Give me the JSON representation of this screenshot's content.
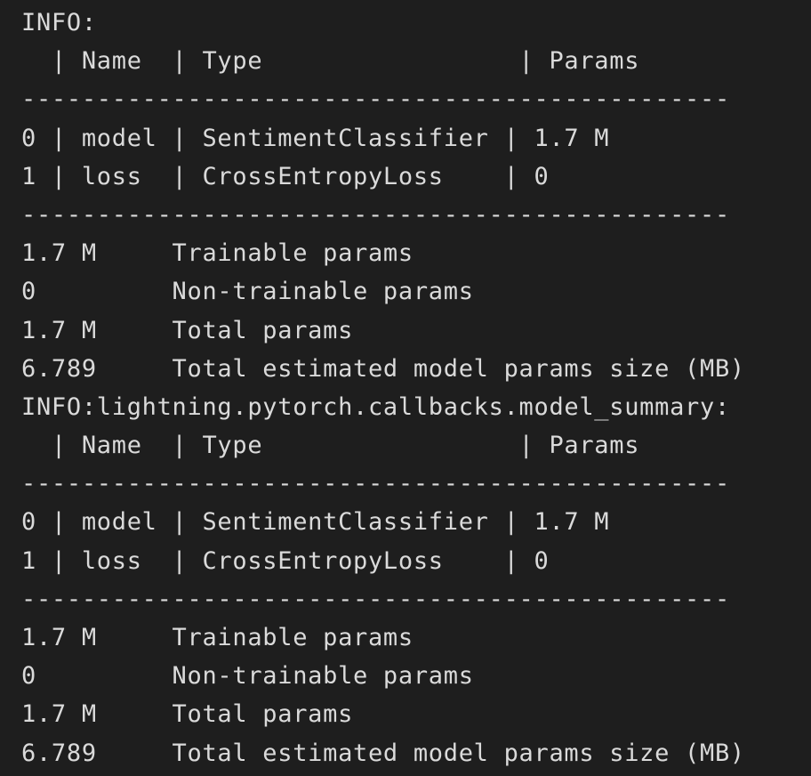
{
  "terminal": {
    "lines": [
      "INFO:",
      "  | Name  | Type                 | Params",
      "-----------------------------------------------",
      "0 | model | SentimentClassifier | 1.7 M",
      "1 | loss  | CrossEntropyLoss    | 0",
      "-----------------------------------------------",
      "1.7 M     Trainable params",
      "0         Non-trainable params",
      "1.7 M     Total params",
      "6.789     Total estimated model params size (MB)",
      "INFO:lightning.pytorch.callbacks.model_summary:",
      "  | Name  | Type                 | Params",
      "-----------------------------------------------",
      "0 | model | SentimentClassifier | 1.7 M",
      "1 | loss  | CrossEntropyLoss    | 0",
      "-----------------------------------------------",
      "1.7 M     Trainable params",
      "0         Non-trainable params",
      "1.7 M     Total params",
      "6.789     Total estimated model params size (MB)"
    ]
  }
}
